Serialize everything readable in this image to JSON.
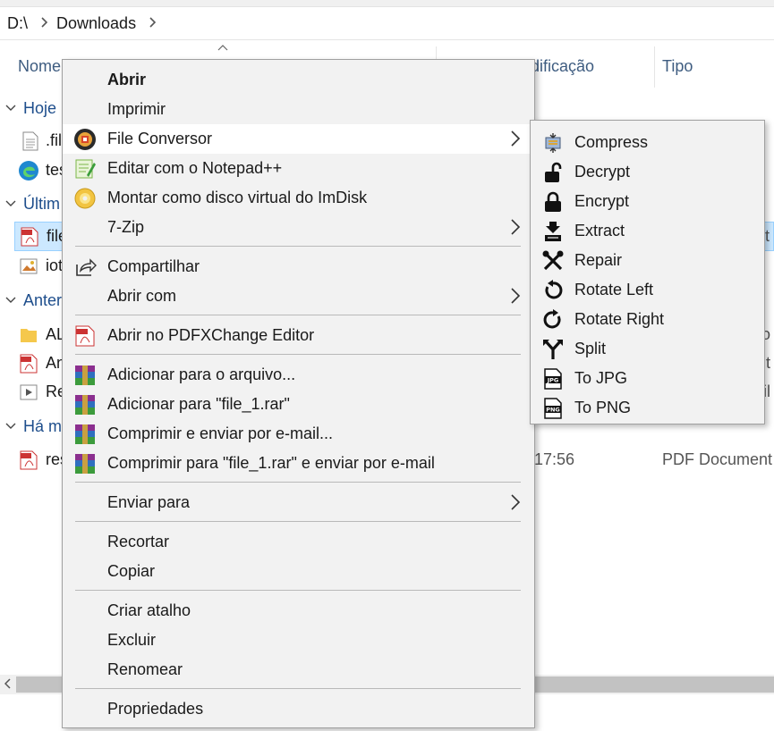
{
  "address": {
    "drive": "D:\\",
    "folder": "Downloads"
  },
  "columns": {
    "name": "Nome",
    "modified": "dificação",
    "type": "Tipo"
  },
  "groups": {
    "today": "Hoje",
    "last": "Últim",
    "earlier": "Anter",
    "long_ago": "Há m"
  },
  "files": [
    {
      "name": ".fil",
      "icon": "text-file-icon"
    },
    {
      "name": "tes",
      "icon": "edge-icon"
    },
    {
      "name": "file",
      "icon": "pdf-icon",
      "peek": "t"
    },
    {
      "name": "iot",
      "icon": "image-file-icon"
    },
    {
      "name": "AL",
      "icon": "folder-icon",
      "peek": "vo"
    },
    {
      "name": "An",
      "icon": "pdf-icon",
      "peek": "t"
    },
    {
      "name": "Re",
      "icon": "video-file-icon",
      "peek": "fil"
    },
    {
      "name": "res",
      "icon": "pdf-icon",
      "time": "17:56",
      "type": "PDF Document"
    }
  ],
  "menu": {
    "open": "Abrir",
    "print": "Imprimir",
    "file_converter": "File Conversor",
    "notepad": "Editar com o Notepad++",
    "imdisk": "Montar como disco virtual do ImDisk",
    "sevenzip": "7-Zip",
    "share": "Compartilhar",
    "open_with": "Abrir com",
    "pdfx": "Abrir no PDFXChange Editor",
    "add_archive": "Adicionar para o arquivo...",
    "add_rar": "Adicionar para \"file_1.rar\"",
    "compress_email": "Comprimir e enviar por e-mail...",
    "compress_rar_email": "Comprimir para \"file_1.rar\" e enviar por e-mail",
    "send_to": "Enviar para",
    "cut": "Recortar",
    "copy": "Copiar",
    "shortcut": "Criar atalho",
    "delete": "Excluir",
    "rename": "Renomear",
    "properties": "Propriedades"
  },
  "submenu": [
    {
      "label": "Compress",
      "icon": "compress-icon"
    },
    {
      "label": "Decrypt",
      "icon": "unlock-icon"
    },
    {
      "label": "Encrypt",
      "icon": "lock-icon"
    },
    {
      "label": "Extract",
      "icon": "extract-icon"
    },
    {
      "label": "Repair",
      "icon": "repair-icon"
    },
    {
      "label": "Rotate Left",
      "icon": "rotate-left-icon"
    },
    {
      "label": "Rotate Right",
      "icon": "rotate-right-icon"
    },
    {
      "label": "Split",
      "icon": "split-icon"
    },
    {
      "label": "To JPG",
      "icon": "jpg-file-icon"
    },
    {
      "label": "To PNG",
      "icon": "png-file-icon"
    }
  ]
}
